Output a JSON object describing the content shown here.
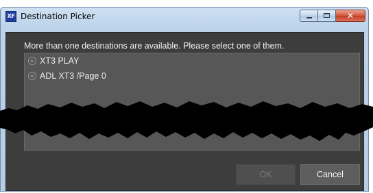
{
  "window": {
    "app_icon_text": "XF",
    "title": "Destination Picker",
    "close_glyph": "✕"
  },
  "dialog": {
    "instruction": "More than one destinations are available. Please select one of them.",
    "options": [
      {
        "label": "XT3 PLAY",
        "selected": false
      },
      {
        "label": "ADL XT3 /Page 0",
        "selected": false
      }
    ],
    "ok_label": "OK",
    "ok_enabled": false,
    "cancel_label": "Cancel"
  },
  "colors": {
    "client_background": "#3d3d3d",
    "list_background": "#575757",
    "title_bar": "#bcd3ea",
    "close_button": "#c23e24"
  }
}
